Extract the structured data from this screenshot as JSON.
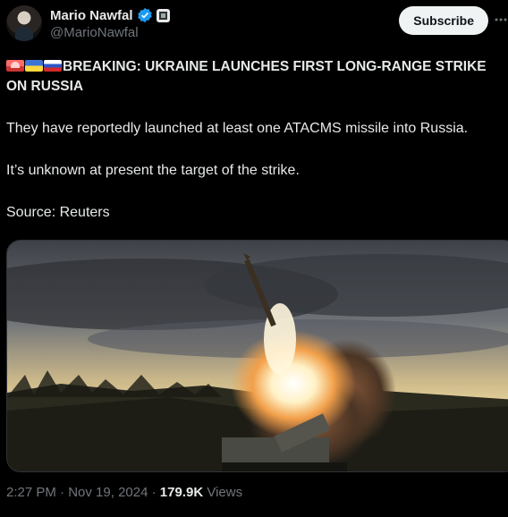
{
  "author": {
    "name": "Mario Nawfal",
    "handle": "@MarioNawfal",
    "verified_color": "#1d9bf0"
  },
  "header": {
    "subscribe_label": "Subscribe",
    "more_icon": "more-icon"
  },
  "post": {
    "headline_line": "BREAKING: UKRAINE LAUNCHES FIRST LONG-RANGE STRIKE ON RUSSIA",
    "paragraph_1": "They have reportedly launched at least one ATACMS missile into Russia.",
    "paragraph_2": "It’s unknown at present the target of the strike.",
    "source": "Source: Reuters",
    "emoji": [
      "siren-icon",
      "flag-ukraine-icon",
      "flag-russia-icon"
    ],
    "media": {
      "alt": "Missile launch from a truck-mounted launcher at dusk"
    }
  },
  "meta": {
    "time": "2:27 PM",
    "separator": "·",
    "date": "Nov 19, 2024",
    "views_count": "179.9K",
    "views_label": "Views"
  },
  "colors": {
    "background": "#000000",
    "text": "#e7e9ea",
    "muted": "#71767b",
    "accent": "#1d9bf0"
  }
}
